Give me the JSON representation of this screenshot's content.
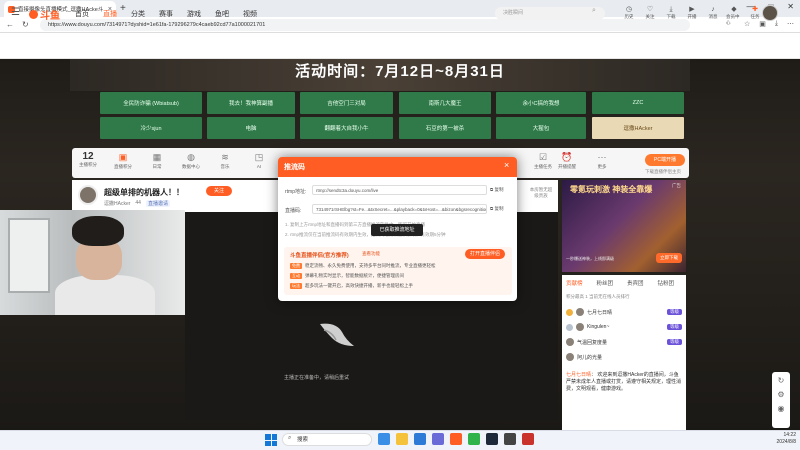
{
  "browser": {
    "tab_title": "直接摄像头直播模式_逗撒HAcke斗",
    "new_tab": "+",
    "url": "https://www.douyu.com/7314971?dyshid=1e61fa-179296279c4caeb92cd77a1000021701",
    "window_controls": [
      "—",
      "□",
      "✕"
    ]
  },
  "site": {
    "logo": "斗鱼",
    "nav": [
      "首页",
      "直播",
      "分类",
      "赛事",
      "游戏",
      "鱼吧",
      "视频"
    ],
    "active_nav": "直播",
    "search_placeholder": "决胜瞬间",
    "header_icons": [
      "历史",
      "关注",
      "下载",
      "开播",
      "消息",
      "会员中心",
      "任务"
    ]
  },
  "banner": {
    "title": "活动时间：7月12日~8月31日",
    "grid": [
      [
        "全民防诈骗 (Wbiatsub)",
        "我去！我神算副播",
        "吉他空门三对局",
        "南斯几大魔王",
        "余小C搞的我想",
        "ZZC"
      ],
      [
        "冷少sjun",
        "电脑",
        "翻翻着大自我小牛",
        "石豆的第一被杀",
        "大猩包",
        "逗撒HAcker"
      ]
    ],
    "highlight": "逗撒HAcker"
  },
  "room_toolbar": {
    "online_count": "12",
    "online_label": "主播积分",
    "items": [
      "直播积分",
      "日常",
      "数据中心",
      "音乐",
      "AI",
      "录播",
      "",
      "",
      "",
      "",
      "",
      "主播任务",
      "开播提醒",
      "更多"
    ],
    "pc_button": "PC端开播",
    "download_link": "下载直播伴侣主页"
  },
  "streamer": {
    "title": "超级单排的机器人！！",
    "follow": "关注",
    "meta": [
      "逗撒HAcker",
      "44",
      "直播邀请"
    ],
    "rank_note": "本房暂无超级贵族"
  },
  "player": {
    "loading_text": "主播正在准备中，请稍后重试"
  },
  "ad": {
    "label": "广告",
    "title": "零氪玩刺激 神装全靠爆",
    "sub": "一秒爆送神装，上线即满级",
    "cta": "立即下载"
  },
  "rank_panel": {
    "tabs": [
      "贡献榜",
      "粉丝团",
      "贵宾团",
      "钻粉团"
    ],
    "active_tab": "贡献榜",
    "subtitle": "积分最高 1  当前无在线人员排行",
    "rows": [
      {
        "name": "七月七日晴",
        "badge": "等级"
      },
      {
        "name": "Kingulen~",
        "badge": "等级"
      },
      {
        "name": "气温回复度量",
        "badge": "等级"
      },
      {
        "name": "阿儿的光量",
        "badge": "等级"
      }
    ],
    "chat_name": "七月七日晴",
    "chat_text": "欢迎来到逗撒HAcker的直播间，斗鱼严禁未成年人直播或打赏，请遵守相关规定，理性消费，文明观看，健康游戏。"
  },
  "modal": {
    "title": "推流码",
    "rtmp_label": "rtmp地址:",
    "rtmp_value": "rtmp://sendtc3a.douyu.com/live",
    "key_label": "直播码:",
    "key_value": "7314971rSHElbg?st=Fe...&txSecret=...&playback=0&txHost=...&bizon&bgsrecognition=0",
    "copy": "复制",
    "notes": [
      "1. 复制上方rtmp地址和直播码到第三方直播推流软件中，即可开始直播",
      "2. rtmp推流仅在当前推流码有效期内生效，推流码过期请重新获取，有效期5分钟"
    ],
    "toast": "已获取推流地址",
    "promo_title": "斗鱼直播伴侣(官方推荐)",
    "promo_link": "查看功能",
    "promo_btn": "打开直播伴侣",
    "promo_lines": [
      {
        "tag": "免费",
        "text": "稳定流畅、永久免费使用，支持多平台同时推流，专业直播更轻松"
      },
      {
        "tag": "互动",
        "text": "弹幕礼物实时显示，智能数据统计，便捷管理房间"
      },
      {
        "tag": "玩法",
        "text": "超多玩法一键开启，高效快捷开播，新手也能轻松上手"
      }
    ]
  },
  "taskbar": {
    "search": "搜索",
    "time": "14:22",
    "date": "2024/8/8"
  }
}
